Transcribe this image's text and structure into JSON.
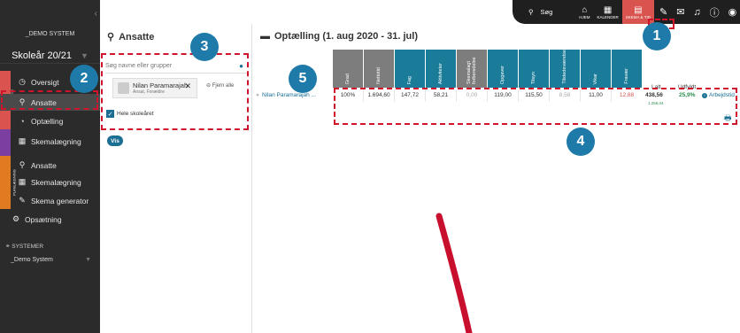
{
  "sidebar": {
    "system_name": "_DEMO SYSTEM",
    "school_year": "Skoleår 20/21",
    "items": [
      {
        "label": "Oversigt",
        "icon": "dashboard-icon"
      },
      {
        "label": "Ansatte",
        "icon": "people-icon"
      },
      {
        "label": "Optælling",
        "icon": "clock-icon"
      },
      {
        "label": "Skemalægning",
        "icon": "calendar-icon"
      },
      {
        "label": "Ansatte",
        "icon": "people-icon"
      },
      {
        "label": "Skemalægning",
        "icon": "calendar-icon"
      },
      {
        "label": "Skema generator",
        "icon": "wand-icon"
      },
      {
        "label": "Opsætning",
        "icon": "gear-icon"
      }
    ],
    "band1": "PERSONALE",
    "band2": "PLANLÆGNING",
    "systems_header": "SYSTEMER",
    "demo_system": "_Demo System"
  },
  "topbar": {
    "search_label": "Søg",
    "home_label": "HJEM",
    "calendar_label": "KALENDER",
    "schedule_label": "SKEMA & TID"
  },
  "employees_panel": {
    "title": "Ansatte",
    "search_placeholder": "Søg navne eller grupper",
    "chip_name": "Nilan Paramarajah",
    "chip_sub": "Ansat, Forældre",
    "remove_all": "Fjern alle",
    "whole_year": "Hele skoleåret",
    "show_button": "Vis"
  },
  "count_panel": {
    "title": "Optælling (1. aug 2020 - 31. jul)",
    "columns": [
      {
        "label": "Grad",
        "style": "grey"
      },
      {
        "label": "Nettotid",
        "style": "grey"
      },
      {
        "label": "Fag",
        "style": "teal"
      },
      {
        "label": "Aktiviteter",
        "style": "teal"
      },
      {
        "label": "Skemalagt forberedelse",
        "style": "grey"
      },
      {
        "label": "Opgaver",
        "style": "teal"
      },
      {
        "label": "Tilsyn",
        "style": "teal"
      },
      {
        "label": "Tilstedeværelse",
        "style": "teal"
      },
      {
        "label": "Vikar",
        "style": "teal"
      },
      {
        "label": "Fravær",
        "style": "teal"
      }
    ],
    "row": {
      "name": "Nilan Paramarajah ...",
      "values": [
        "100%",
        "1.694,60",
        "147,72",
        "58,21",
        "0,00",
        "119,00",
        "115,50",
        "8,58",
        "11,00",
        "12,88"
      ],
      "ialt_label": "I alt",
      "ialt": "438,56",
      "ialt_sub": "1.256,04",
      "udfyldt_label": "Udfyldt",
      "udfyldt": "25,9%",
      "arbejd": "Arbejdstid"
    }
  },
  "annotations": [
    "1",
    "2",
    "3",
    "4",
    "5"
  ]
}
